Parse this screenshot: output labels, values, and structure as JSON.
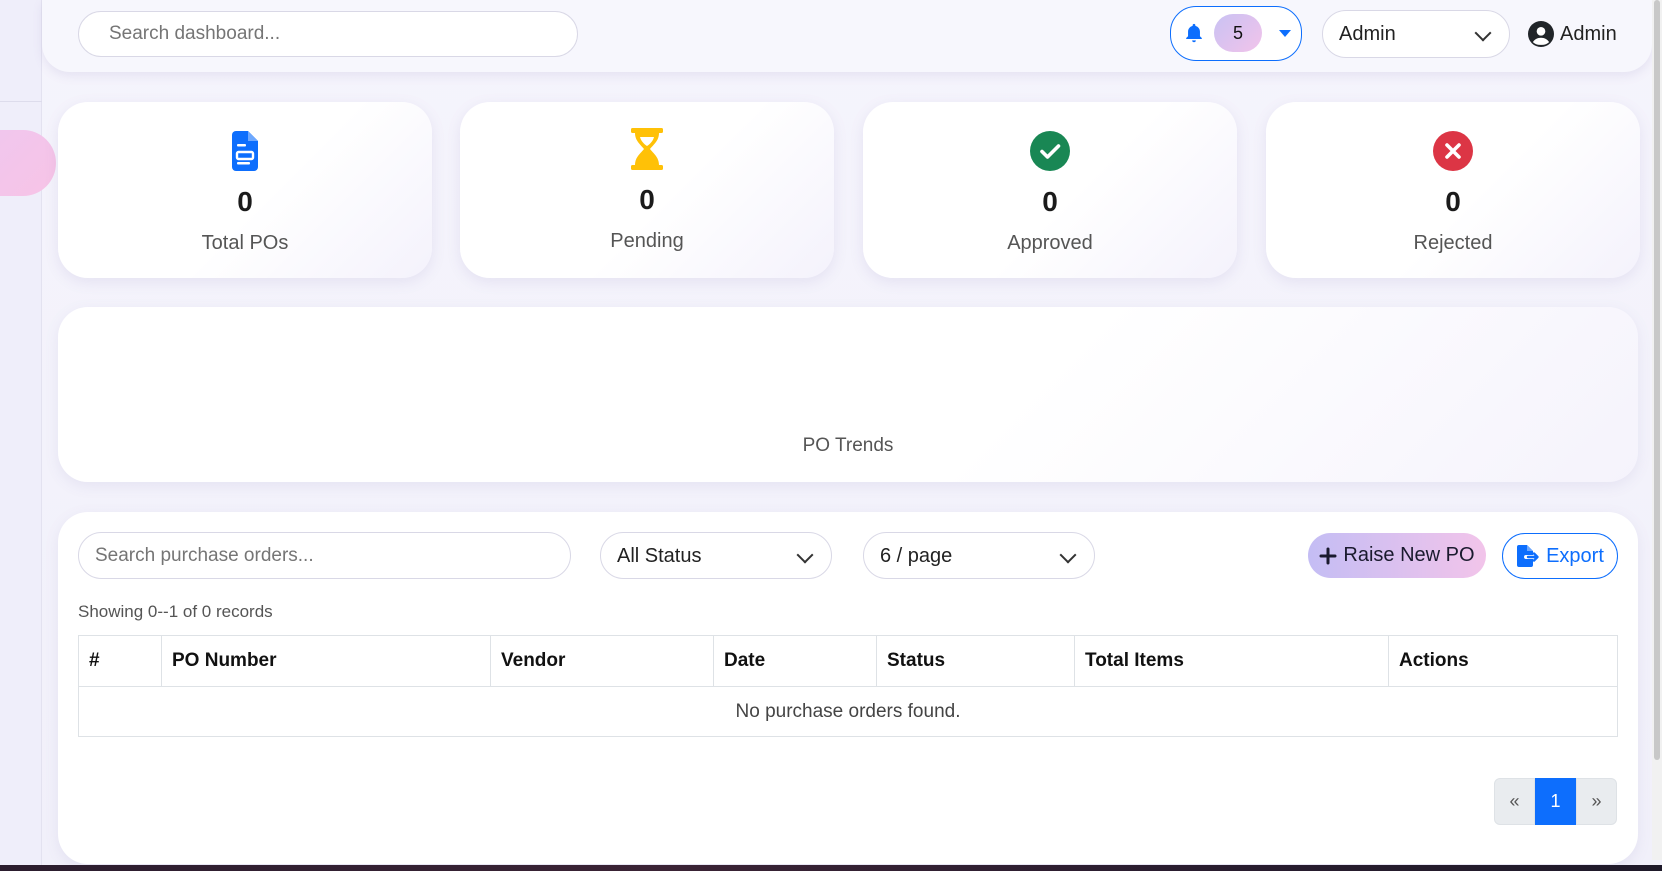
{
  "header": {
    "search_placeholder": "Search dashboard...",
    "notifications": {
      "count": "5"
    },
    "role_select": {
      "value": "Admin"
    },
    "user": {
      "name": "Admin"
    }
  },
  "stats": [
    {
      "value": "0",
      "label": "Total POs",
      "icon": "document-icon",
      "color": "#0d6efd"
    },
    {
      "value": "0",
      "label": "Pending",
      "icon": "hourglass-icon",
      "color": "#ffc107"
    },
    {
      "value": "0",
      "label": "Approved",
      "icon": "check-circle-icon",
      "color": "#198754"
    },
    {
      "value": "0",
      "label": "Rejected",
      "icon": "x-circle-icon",
      "color": "#dc3545"
    }
  ],
  "trend": {
    "caption": "PO Trends"
  },
  "orders": {
    "search_placeholder": "Search purchase orders...",
    "status_filter": "All Status",
    "page_size": "6 / page",
    "raise_label": "Raise New PO",
    "export_label": "Export",
    "showing": "Showing 0--1 of 0 records",
    "columns": [
      "#",
      "PO Number",
      "Vendor",
      "Date",
      "Status",
      "Total Items",
      "Actions"
    ],
    "empty": "No purchase orders found.",
    "pagination": {
      "prev": "«",
      "current": "1",
      "next": "»"
    }
  },
  "colors": {
    "primary": "#0d6efd",
    "accent_gradient_start": "#c4bdf4",
    "accent_gradient_end": "#f2c4ea"
  }
}
